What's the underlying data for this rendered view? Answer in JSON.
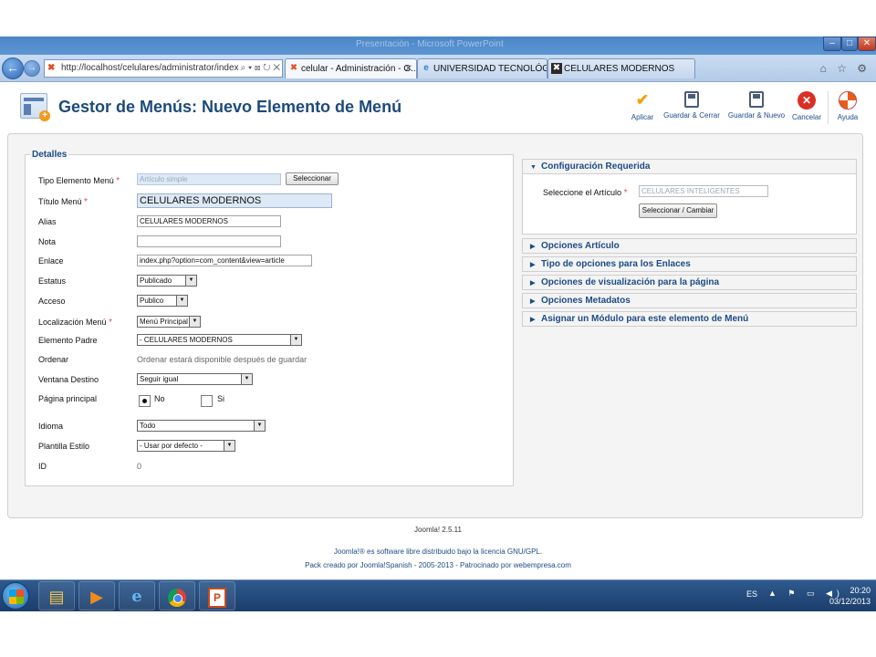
{
  "browser": {
    "window_title": "Presentación - Microsoft PowerPoint",
    "min_label": "–",
    "max_label": "□",
    "close_label": "✕",
    "address": "http://localhost/celulares/administrator/index.p",
    "address_tools": "⌕ ▾ ⊠ ↻ ✕",
    "tabs": [
      {
        "label": "celular - Administración - G...",
        "icon": "joomla-icon",
        "active": true
      },
      {
        "label": "UNIVERSIDAD TECNOLÓGICA ...",
        "icon": "ie-icon",
        "active": false
      },
      {
        "label": "CELULARES MODERNOS",
        "icon": "joomla-icon",
        "active": false
      }
    ],
    "tab_close": "✕",
    "icons": "⌂ ☆ ⚙"
  },
  "page": {
    "title": "Gestor de Menús: Nuevo Elemento de Menú",
    "toolbar": {
      "apply": "Aplicar",
      "save_close": "Guardar & Cerrar",
      "save_new": "Guardar & Nuevo",
      "cancel": "Cancelar",
      "help": "Ayuda"
    },
    "details": {
      "legend": "Detalles",
      "labels": {
        "tipo": "Tipo Elemento Menú",
        "titulo": "Título Menú",
        "alias": "Alias",
        "nota": "Nota",
        "enlace": "Enlace",
        "estatus": "Estatus",
        "acceso": "Acceso",
        "localizacion": "Localización Menú",
        "padre": "Elemento Padre",
        "ordenar": "Ordenar",
        "ventana": "Ventana Destino",
        "principal": "Página principal",
        "idioma": "Idioma",
        "plantilla": "Plantilla Estilo",
        "id": "ID"
      },
      "required_mark": "*",
      "values": {
        "tipo": "Artículo simple",
        "titulo": "CELULARES MODERNOS",
        "alias": "CELULARES MODERNOS",
        "nota": "",
        "enlace": "index.php?option=com_content&view=article",
        "estatus": "Publicado",
        "acceso": "Publico",
        "localizacion": "Menú Principal",
        "padre": "- CELULARES MODERNOS",
        "ordenar": "Ordenar estará disponible después de guardar",
        "ventana": "Seguir igual",
        "principal_no": "No",
        "principal_si": "Si",
        "idioma": "Todo",
        "plantilla": "- Usar por defecto -",
        "id": "0"
      },
      "select_button": "Seleccionar"
    },
    "config": {
      "title": "Configuración Requerida",
      "article_label": "Seleccione el Artículo",
      "article_value": "CELULARES INTELIGENTES",
      "change_button": "Seleccionar / Cambiar"
    },
    "accordions": [
      "Opciones Artículo",
      "Tipo de opciones para los Enlaces",
      "Opciones de visualización para la página",
      "Opciones Metadatos",
      "Asignar un Módulo para este elemento de Menú"
    ],
    "footer": {
      "version": "Joomla! 2.5.11",
      "license": "Joomla!® es software libre distribuido bajo la licencia GNU/GPL.",
      "pack": "Pack creado por Joomla!Spanish - 2005-2013 - Patrocinado por webempresa.com"
    }
  },
  "taskbar": {
    "lang": "ES",
    "tray_icons": "▲ ⚑ ▭ ◀)",
    "time": "20:20",
    "date": "03/12/2013"
  },
  "colors": {
    "brand_blue": "#1c4b85",
    "required_red": "#d9534f",
    "apply_orange": "#f2a20b",
    "cancel_red": "#d93025"
  }
}
